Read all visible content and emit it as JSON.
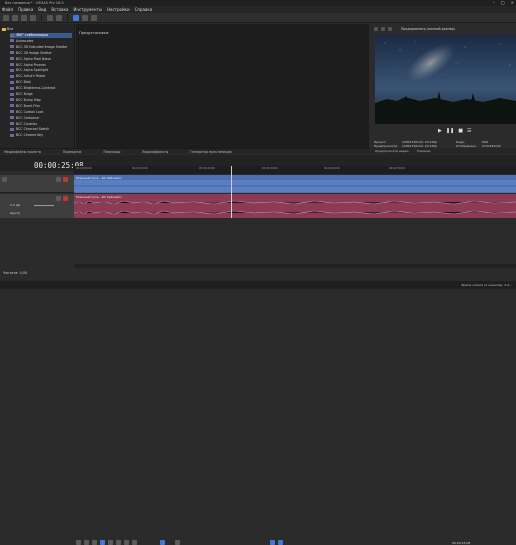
{
  "window": {
    "title": "Без названия * - VEGAS Pro 16.0"
  },
  "menu": [
    "Файл",
    "Правка",
    "Вид",
    "Вставка",
    "Инструменты",
    "Настройки",
    "Справка"
  ],
  "explorer": {
    "root": "Все",
    "items": [
      "360° стабилизация",
      "Autoscales",
      "BCC 3D Extruded Image Shatter",
      "BCC 3D Image Shatter",
      "BCC Alpha Pixel Noise",
      "BCC Alpha Process",
      "BCC Alpha Spotlight",
      "BCC Artist's Poster",
      "BCC Blob",
      "BCC Brightness-Contrast",
      "BCC Bulge",
      "BCC Bump Map",
      "BCC Burnt Film",
      "BCC Carbon Lock",
      "BCC Cartooner",
      "BCC Caustics",
      "BCC Charcoal Sketch",
      "BCC Chrome Key"
    ],
    "selected_index": 0
  },
  "fx_pane": {
    "header": "Предустановки:"
  },
  "left_tabs": [
    "Медиафайлы проекта",
    "Проводник",
    "Переходы",
    "Видеоэффекты",
    "Генератор мультимедиа"
  ],
  "preview": {
    "head_label": "Предпросмотр (полный размер)",
    "info": {
      "project_label": "Проект:",
      "project_value": "1280x720x32; 23,976p",
      "preview_label": "Предпросмотр:",
      "preview_value": "1280x720x32; 23,976p",
      "frame_label": "Кадр:",
      "frame_value": "608",
      "display_label": "Отображено:",
      "display_value": "570x320x32"
    },
    "tabs": [
      "Предпросмотр видео",
      "Триммер"
    ]
  },
  "timeline": {
    "timecode": "00:00:25:08",
    "ruler_ticks": [
      "00:00:00;00",
      "00:00:10;00",
      "00:00:20;00",
      "00:00:30;00",
      "00:00:40;00",
      "00:00:50;00"
    ],
    "video_clip": "Млечный путь - 4К Таймлапс",
    "audio_clip": "Млечный путь - 4К Таймлапс",
    "audio_header": {
      "volume": "0,0 дБ",
      "pan": "Центр"
    },
    "rate": "Частота: 0,00",
    "end_time": "00:00:25;08"
  },
  "status": {
    "text": "Время записи (2 каналов): 2:9..."
  },
  "colors": {
    "video_track": "#4a6fb3",
    "audio_track": "#8c3b55",
    "accent": "#3d7bd6"
  }
}
